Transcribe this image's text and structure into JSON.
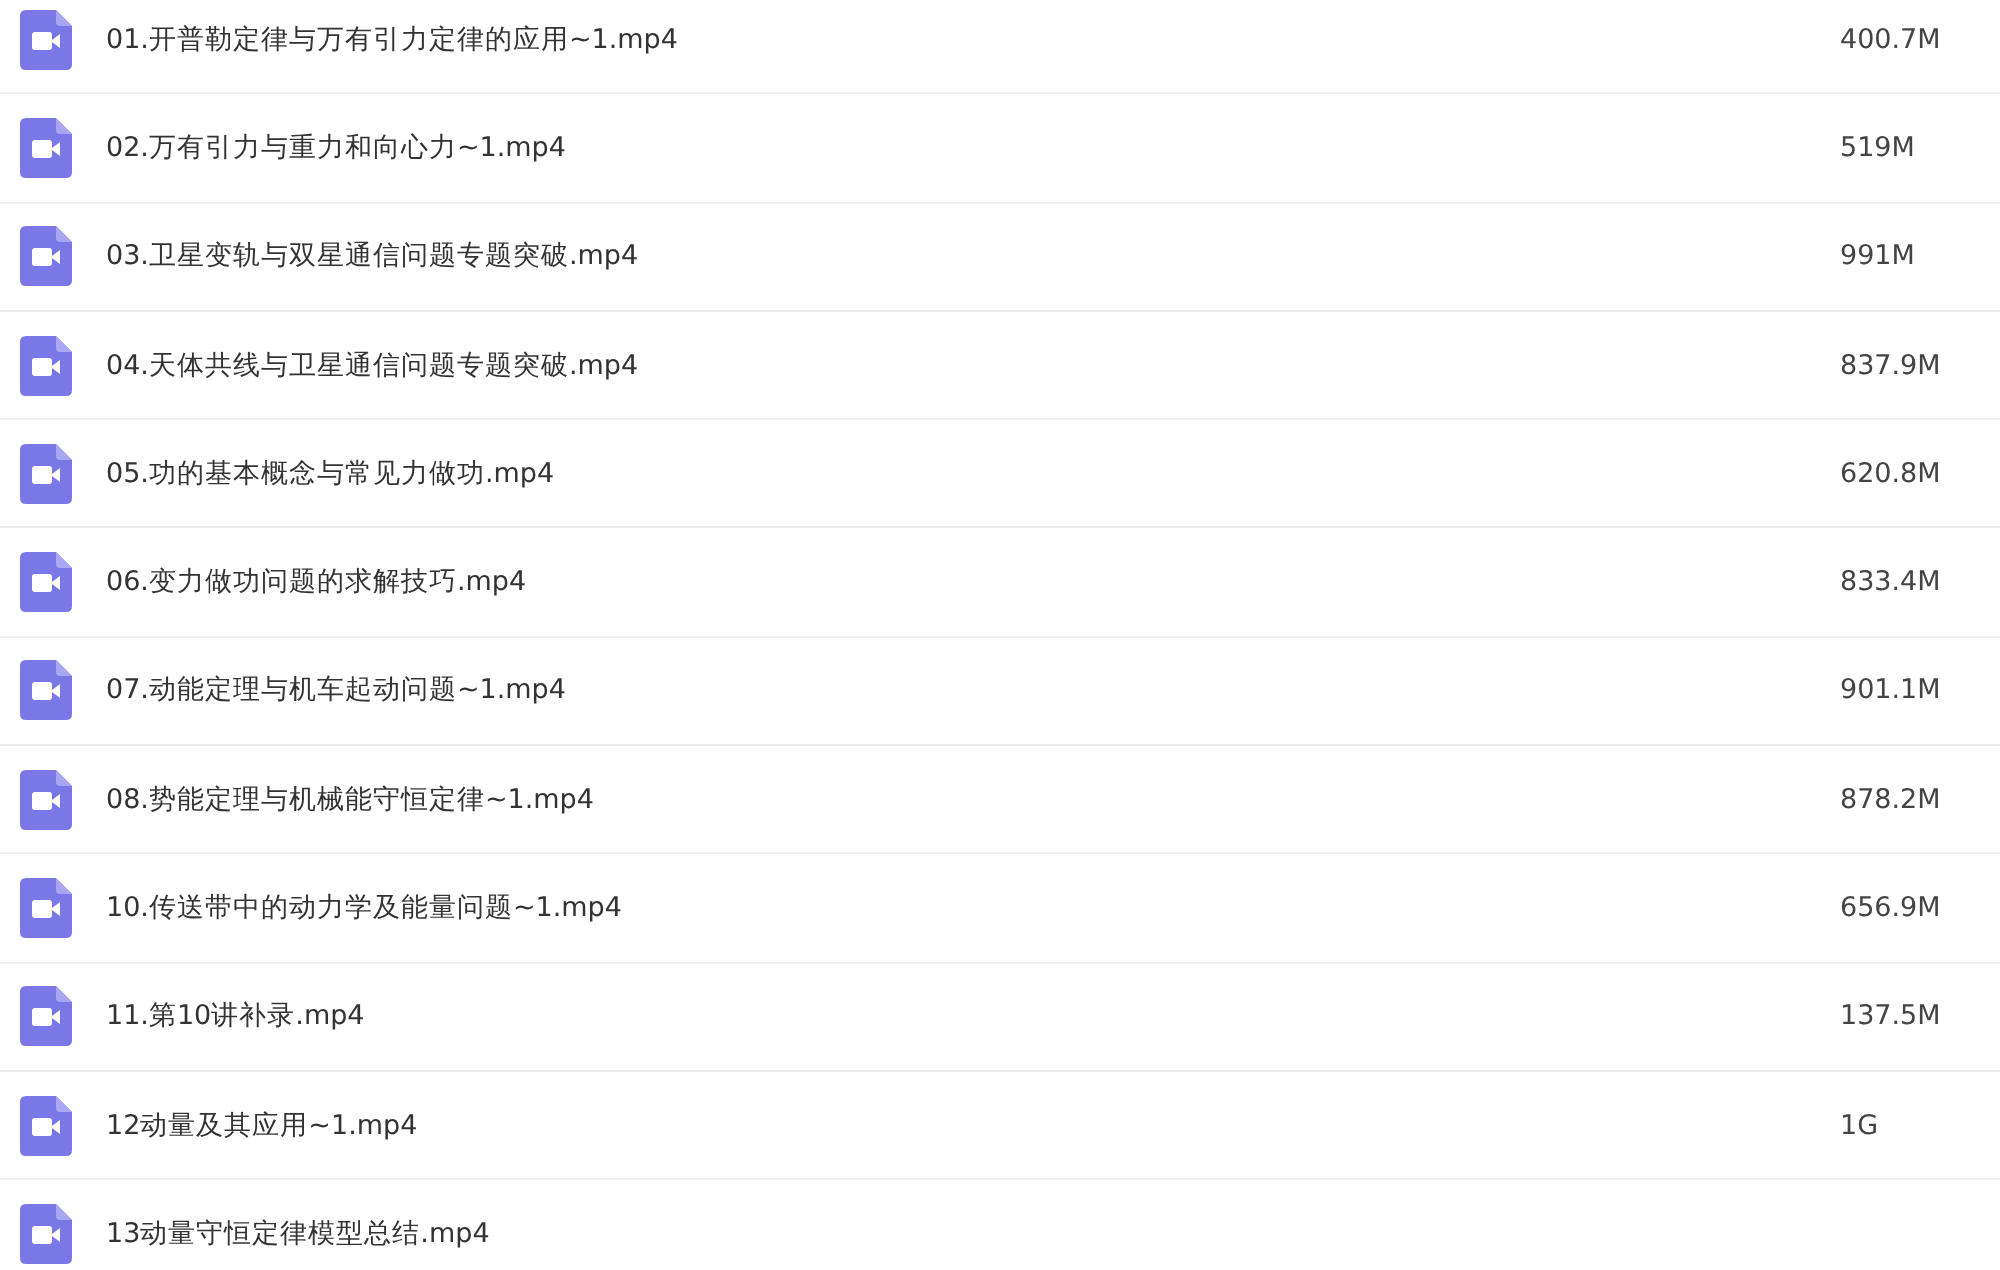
{
  "files": [
    {
      "name": "01.开普勒定律与万有引力定律的应用~1.mp4",
      "size": "400.7M"
    },
    {
      "name": "02.万有引力与重力和向心力~1.mp4",
      "size": "519M"
    },
    {
      "name": "03.卫星变轨与双星通信问题专题突破.mp4",
      "size": "991M"
    },
    {
      "name": "04.天体共线与卫星通信问题专题突破.mp4",
      "size": "837.9M"
    },
    {
      "name": "05.功的基本概念与常见力做功.mp4",
      "size": "620.8M"
    },
    {
      "name": "06.变力做功问题的求解技巧.mp4",
      "size": "833.4M"
    },
    {
      "name": "07.动能定理与机车起动问题~1.mp4",
      "size": "901.1M"
    },
    {
      "name": "08.势能定理与机械能守恒定律~1.mp4",
      "size": "878.2M"
    },
    {
      "name": "10.传送带中的动力学及能量问题~1.mp4",
      "size": "656.9M"
    },
    {
      "name": "11.第10讲补录.mp4",
      "size": "137.5M"
    },
    {
      "name": "12动量及其应用~1.mp4",
      "size": "1G"
    },
    {
      "name": "13动量守恒定律模型总结.mp4"
    }
  ]
}
